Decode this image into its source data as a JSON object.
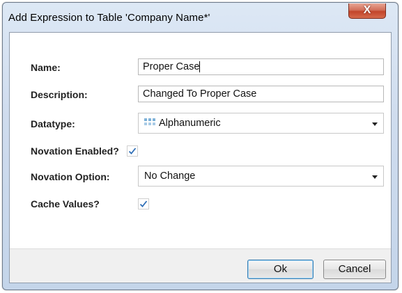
{
  "window": {
    "title": "Add Expression to Table 'Company Name*'",
    "close_glyph": "X"
  },
  "form": {
    "name": {
      "label": "Name:",
      "value": "Proper Case"
    },
    "description": {
      "label": "Description:",
      "value": "Changed To Proper Case"
    },
    "datatype": {
      "label": "Datatype:",
      "value": "Alphanumeric",
      "icon": "alphanumeric-grid-icon"
    },
    "novation_enabled": {
      "label": "Novation Enabled?",
      "checked": true
    },
    "novation_option": {
      "label": "Novation Option:",
      "value": "No Change"
    },
    "cache_values": {
      "label": "Cache Values?",
      "checked": true
    }
  },
  "buttons": {
    "ok_label": "Ok",
    "cancel_label": "Cancel"
  },
  "colors": {
    "titlebar": "#cfdcee",
    "close_button": "#c2452b",
    "check": "#2f6fb7",
    "default_button_border": "#3c7fb1"
  }
}
